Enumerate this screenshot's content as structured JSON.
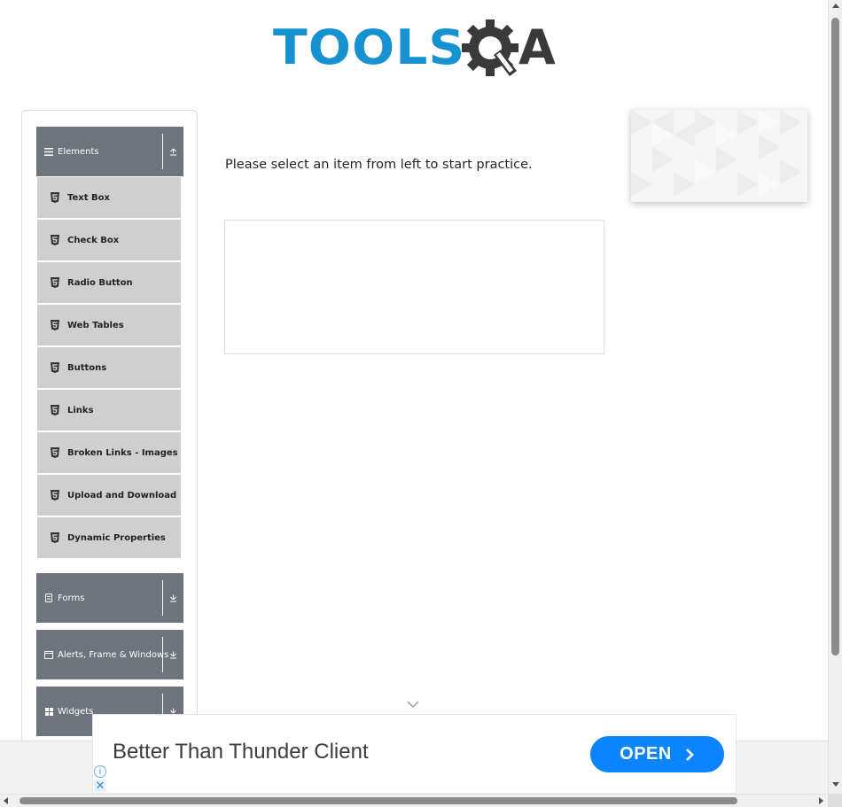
{
  "header": {
    "logo_text_tools": "TOOLS",
    "logo_text_a": "A",
    "logo_colors": {
      "tools": "#1692d1",
      "qa": "#3a3a3a"
    }
  },
  "sidebar": {
    "groups": [
      {
        "label": "Elements",
        "icon": "hamburger-icon",
        "toggle_icon": "collapse-up-icon",
        "expanded": true
      },
      {
        "label": "Forms",
        "icon": "document-icon",
        "toggle_icon": "expand-down-icon",
        "expanded": false
      },
      {
        "label": "Alerts, Frame & Windows",
        "icon": "window-icon",
        "toggle_icon": "expand-down-icon",
        "expanded": false
      },
      {
        "label": "Widgets",
        "icon": "grid-icon",
        "toggle_icon": "expand-down-icon",
        "expanded": false
      }
    ],
    "element_items": [
      {
        "label": "Text Box",
        "icon": "html5-icon"
      },
      {
        "label": "Check Box",
        "icon": "html5-icon"
      },
      {
        "label": "Radio Button",
        "icon": "html5-icon"
      },
      {
        "label": "Web Tables",
        "icon": "html5-icon"
      },
      {
        "label": "Buttons",
        "icon": "html5-icon"
      },
      {
        "label": "Links",
        "icon": "html5-icon"
      },
      {
        "label": "Broken Links - Images",
        "icon": "html5-icon"
      },
      {
        "label": "Upload and Download",
        "icon": "html5-icon"
      },
      {
        "label": "Dynamic Properties",
        "icon": "html5-icon"
      }
    ],
    "colors": {
      "group_bg": "#6d747d",
      "item_bg": "#cfcfcf"
    }
  },
  "main": {
    "intro_text": "Please select an item from left to start practice."
  },
  "ad": {
    "title": "Better Than Thunder Client",
    "button_label": "OPEN",
    "button_icon": "chevron-right-icon",
    "info_glyph": "i",
    "close_glyph": "✕",
    "button_color": "#0a84ff"
  }
}
